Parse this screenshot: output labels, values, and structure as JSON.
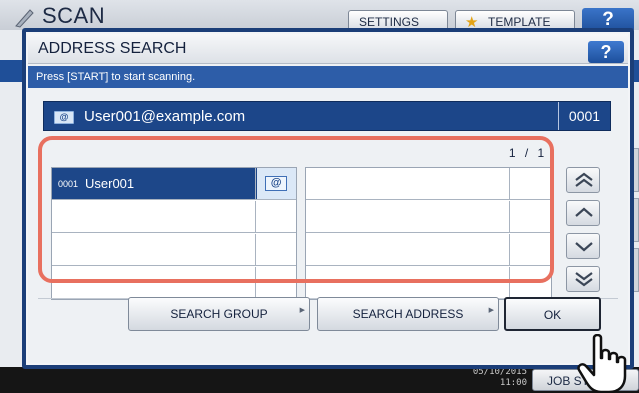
{
  "background": {
    "title": "SCAN",
    "settings_label": "SETTINGS",
    "template_label": "TEMPLATE",
    "help_label": "?",
    "job_status_label": "JOB STATUS",
    "date": "05/10/2015",
    "time": "11:00"
  },
  "dialog": {
    "title": "ADDRESS SEARCH",
    "help_label": "?",
    "message": "Press [START] to start scanning.",
    "destination": {
      "icon": "email-icon",
      "address": "User001@example.com",
      "count": "0001"
    },
    "page_indicator": "1 / 1",
    "results": [
      {
        "number": "0001",
        "name": "User001",
        "icon": "email-icon",
        "selected": true
      }
    ],
    "scroll_buttons": [
      "scroll-top",
      "scroll-up",
      "scroll-down",
      "scroll-bottom"
    ],
    "buttons": {
      "search_group": "SEARCH GROUP",
      "search_address": "SEARCH ADDRESS",
      "ok": "OK"
    }
  },
  "colors": {
    "dialog_frame": "#1b3e78",
    "selected_row": "#1d4789",
    "highlight": "#e8705f"
  }
}
